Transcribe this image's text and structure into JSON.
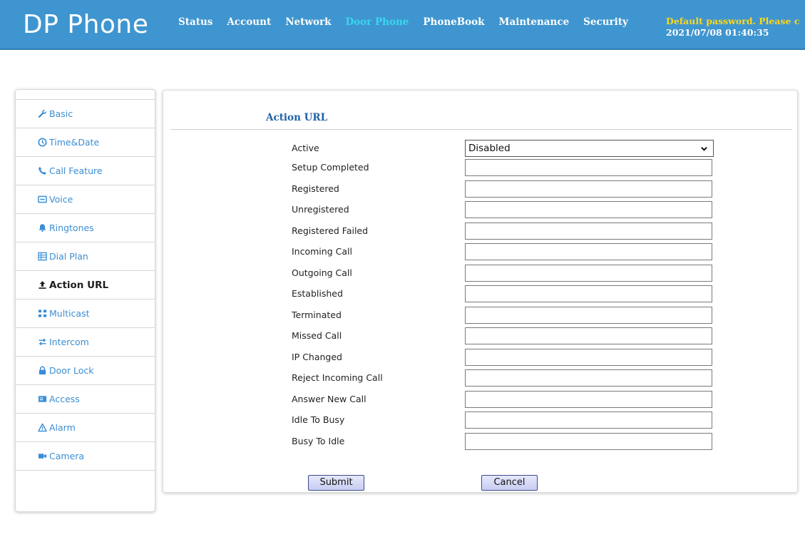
{
  "header": {
    "brand": "DP Phone",
    "nav": [
      "Status",
      "Account",
      "Network",
      "Door Phone",
      "PhoneBook",
      "Maintenance",
      "Security"
    ],
    "active_nav": "Door Phone",
    "warning": "Default password. Please c",
    "datetime": "2021/07/08 01:40:35",
    "colors": {
      "bar": "#3f95cf",
      "active_nav": "#3ad6ee",
      "warning": "#ffd81c"
    }
  },
  "sidebar": {
    "items": [
      {
        "label": "Basic",
        "icon": "wrench-icon"
      },
      {
        "label": "Time&Date",
        "icon": "clock-icon"
      },
      {
        "label": "Call Feature",
        "icon": "phone-icon"
      },
      {
        "label": "Voice",
        "icon": "voice-icon"
      },
      {
        "label": "Ringtones",
        "icon": "bell-icon"
      },
      {
        "label": "Dial Plan",
        "icon": "table-icon"
      },
      {
        "label": "Action URL",
        "icon": "upload-icon"
      },
      {
        "label": "Multicast",
        "icon": "multicast-icon"
      },
      {
        "label": "Intercom",
        "icon": "exchange-icon"
      },
      {
        "label": "Door Lock",
        "icon": "lock-icon"
      },
      {
        "label": "Access",
        "icon": "card-icon"
      },
      {
        "label": "Alarm",
        "icon": "warning-icon"
      },
      {
        "label": "Camera",
        "icon": "camera-icon"
      }
    ],
    "active": "Action URL"
  },
  "form": {
    "title": "Action URL",
    "active_label": "Active",
    "active_value": "Disabled",
    "fields": [
      {
        "label": "Setup Completed",
        "value": ""
      },
      {
        "label": "Registered",
        "value": ""
      },
      {
        "label": "Unregistered",
        "value": ""
      },
      {
        "label": "Registered Failed",
        "value": ""
      },
      {
        "label": "Incoming Call",
        "value": ""
      },
      {
        "label": "Outgoing Call",
        "value": ""
      },
      {
        "label": "Established",
        "value": ""
      },
      {
        "label": "Terminated",
        "value": ""
      },
      {
        "label": "Missed Call",
        "value": ""
      },
      {
        "label": "IP Changed",
        "value": ""
      },
      {
        "label": "Reject Incoming Call",
        "value": ""
      },
      {
        "label": "Answer New Call",
        "value": ""
      },
      {
        "label": "Idle To Busy",
        "value": ""
      },
      {
        "label": "Busy To Idle",
        "value": ""
      }
    ],
    "submit_label": "Submit",
    "cancel_label": "Cancel"
  }
}
